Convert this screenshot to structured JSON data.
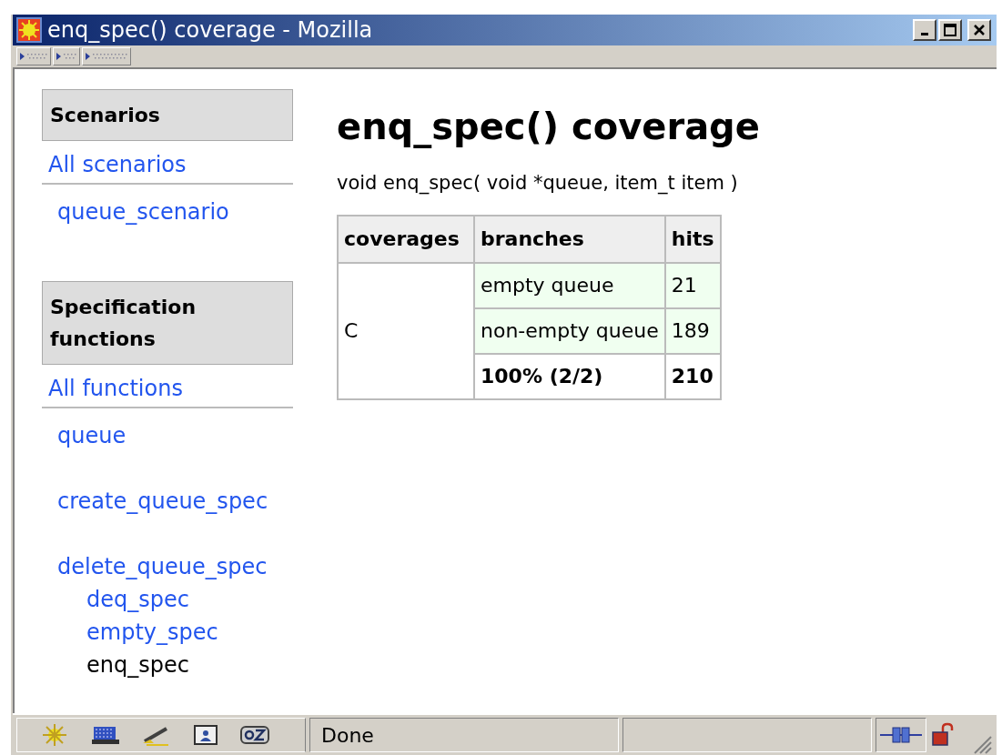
{
  "window": {
    "title": "enq_spec() coverage - Mozilla"
  },
  "sidebar": {
    "sections": [
      {
        "header": "Scenarios",
        "all_link": "All scenarios",
        "items": [
          {
            "label": "queue_scenario",
            "current": false
          }
        ]
      },
      {
        "header": "Specification functions",
        "all_link": "All functions",
        "items": [
          {
            "label": "queue",
            "current": false
          },
          {
            "label": "create_queue_spec",
            "current": false
          },
          {
            "label": "delete_queue_spec",
            "current": false,
            "children": [
              {
                "label": "deq_spec",
                "current": false
              },
              {
                "label": "empty_spec",
                "current": false
              },
              {
                "label": "enq_spec",
                "current": true
              }
            ]
          }
        ]
      }
    ]
  },
  "page": {
    "heading": "enq_spec() coverage",
    "signature": "void enq_spec( void *queue, item_t item )",
    "table": {
      "columns": [
        "coverages",
        "branches",
        "hits"
      ],
      "coverage": "C",
      "rows": [
        {
          "branch": "empty queue",
          "hits": "21"
        },
        {
          "branch": "non-empty queue",
          "hits": "189"
        }
      ],
      "total": {
        "branch": "100% (2/2)",
        "hits": "210"
      }
    }
  },
  "status_bar": {
    "text": "Done"
  }
}
